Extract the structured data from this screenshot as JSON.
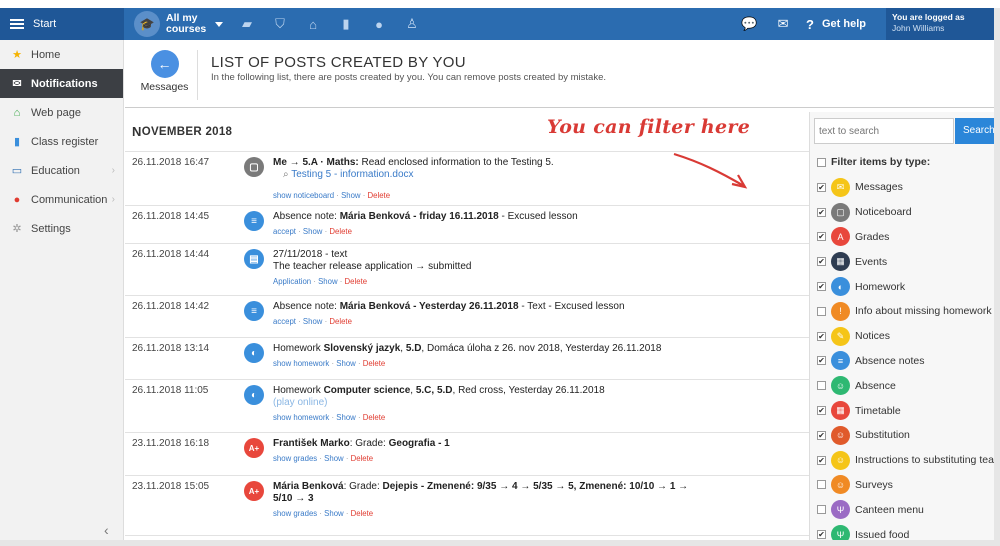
{
  "topbar": {
    "start_label": "Start",
    "courses_label": "All my courses",
    "icons": [
      "graduation-cap-icon",
      "briefcase-icon",
      "shield-icon",
      "bank-icon",
      "bar-chart-icon",
      "soccer-icon",
      "running-icon"
    ],
    "get_help": "Get help",
    "logged_in_label": "You are logged as",
    "user_name": "John Williams"
  },
  "sidebar": {
    "items": [
      {
        "label": "Home",
        "icon": "star-icon"
      },
      {
        "label": "Notifications",
        "icon": "envelope-icon"
      },
      {
        "label": "Web page",
        "icon": "house-icon"
      },
      {
        "label": "Class register",
        "icon": "book-icon"
      },
      {
        "label": "Education",
        "icon": "open-book-icon"
      },
      {
        "label": "Communication",
        "icon": "chat-icon"
      },
      {
        "label": "Settings",
        "icon": "gear-icon"
      }
    ]
  },
  "header": {
    "back_label": "Messages",
    "title": "LIST OF POSTS CREATED BY YOU",
    "description": "In the following list, there are posts created by you. You can remove posts created by mistake."
  },
  "annotation": "You can filter here",
  "month": {
    "first": "N",
    "rest": "OVEMBER 2018"
  },
  "posts": [
    {
      "date": "26.11.2018 16:47",
      "icon_color": "#7a7a7a",
      "icon_glyph": "▢",
      "line1_bold": "Me → 5.A · Maths:",
      "line1_rest": " Read enclosed information to the Testing 5.",
      "attachment": "Testing 5 - information.docx",
      "actions": [
        "show noticeboard",
        "Show",
        "Delete"
      ]
    },
    {
      "date": "26.11.2018 14:45",
      "icon_color": "#3a8fdc",
      "icon_glyph": "≡",
      "pre": "Absence note: ",
      "bold": "Mária Benková - friday 16.11.2018",
      "post": " - Excused lesson",
      "actions": [
        "accept",
        "Show",
        "Delete"
      ]
    },
    {
      "date": "26.11.2018 14:44",
      "icon_color": "#3a8fdc",
      "icon_glyph": "▤",
      "line1": "27/11/2018 - text",
      "line2": "The teacher release application → submitted",
      "actions": [
        "Application",
        "Show",
        "Delete"
      ]
    },
    {
      "date": "26.11.2018 14:42",
      "icon_color": "#3a8fdc",
      "icon_glyph": "≡",
      "pre": "Absence note: ",
      "bold": "Mária Benková - Yesterday 26.11.2018",
      "post": " - Text - Excused lesson",
      "actions": [
        "accept",
        "Show",
        "Delete"
      ]
    },
    {
      "date": "26.11.2018 13:14",
      "icon_color": "#3a8fdc",
      "icon_glyph": "◐",
      "pre": "Homework ",
      "bold": "Slovenský jazyk",
      "mid": ", ",
      "bold2": "5.D",
      "post": ", Domáca úloha z 26. nov 2018, Yesterday 26.11.2018",
      "actions": [
        "show homework",
        "Show",
        "Delete"
      ]
    },
    {
      "date": "26.11.2018 11:05",
      "icon_color": "#3a8fdc",
      "icon_glyph": "◐",
      "pre": "Homework ",
      "bold": "Computer science",
      "mid": ", ",
      "bold2": "5.C, 5.D",
      "post": ", Red cross, Yesterday 26.11.2018",
      "extra": "(play online)",
      "actions": [
        "show homework",
        "Show",
        "Delete"
      ]
    },
    {
      "date": "23.11.2018 16:18",
      "icon_color": "#e8473c",
      "icon_glyph": "A+",
      "bold": "František Marko",
      "mid": ": Grade: ",
      "bold2": "Geografia - 1",
      "actions": [
        "show grades",
        "Show",
        "Delete"
      ]
    },
    {
      "date": "23.11.2018 15:05",
      "icon_color": "#e8473c",
      "icon_glyph": "A+",
      "bold": "Mária Benková",
      "mid": ": Grade: ",
      "bold2": "Dejepis - Zmenené: 9/35 → 4 → 5/35 → 5, Zmenené: 10/10 → 1 → 5/10 → 3",
      "actions": [
        "show grades",
        "Show",
        "Delete"
      ]
    }
  ],
  "filter": {
    "search_placeholder": "text to search",
    "search_button": "Search",
    "title": "Filter items by type:",
    "items": [
      {
        "label": "Messages",
        "checked": true,
        "color": "#f5c518",
        "glyph": "✉"
      },
      {
        "label": "Noticeboard",
        "checked": true,
        "color": "#7a7a7a",
        "glyph": "▢"
      },
      {
        "label": "Grades",
        "checked": true,
        "color": "#e8473c",
        "glyph": "A"
      },
      {
        "label": "Events",
        "checked": true,
        "color": "#2f3d52",
        "glyph": "▦"
      },
      {
        "label": "Homework",
        "checked": true,
        "color": "#3a8fdc",
        "glyph": "◐"
      },
      {
        "label": "Info about missing homework",
        "checked": false,
        "color": "#f08a24",
        "glyph": "!"
      },
      {
        "label": "Notices",
        "checked": true,
        "color": "#f5c518",
        "glyph": "✎"
      },
      {
        "label": "Absence notes",
        "checked": true,
        "color": "#3a8fdc",
        "glyph": "≡"
      },
      {
        "label": "Absence",
        "checked": false,
        "color": "#2eb872",
        "glyph": "☺"
      },
      {
        "label": "Timetable",
        "checked": true,
        "color": "#e8473c",
        "glyph": "▦"
      },
      {
        "label": "Substitution",
        "checked": true,
        "color": "#e05a2b",
        "glyph": "☺"
      },
      {
        "label": "Instructions to substituting teacher",
        "checked": true,
        "color": "#f5c518",
        "glyph": "☺"
      },
      {
        "label": "Surveys",
        "checked": false,
        "color": "#f08a24",
        "glyph": "☺"
      },
      {
        "label": "Canteen menu",
        "checked": false,
        "color": "#9b6bc4",
        "glyph": "Ψ"
      },
      {
        "label": "Issued food",
        "checked": true,
        "color": "#2eb872",
        "glyph": "Ψ"
      }
    ]
  }
}
